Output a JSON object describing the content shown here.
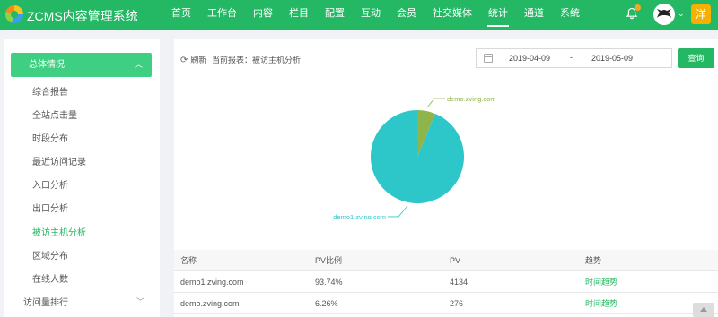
{
  "header": {
    "brand": "ZCMS内容管理系统",
    "nav": [
      "首页",
      "工作台",
      "内容",
      "栏目",
      "配置",
      "互动",
      "会员",
      "社交媒体",
      "统计",
      "通道",
      "系统"
    ],
    "active_nav": "统计",
    "user_badge": "洋",
    "notification_count": "0"
  },
  "sidebar": {
    "group_label": "总体情况",
    "items": [
      "综合报告",
      "全站点击量",
      "时段分布",
      "最近访问记录",
      "入口分析",
      "出口分析",
      "被访主机分析",
      "区域分布",
      "在线人数"
    ],
    "active_item": "被访主机分析",
    "group2_label": "访问量排行"
  },
  "toolbar": {
    "refresh": "刷新",
    "current_report": "当前报表：被访主机分析",
    "date_from": "2019-04-09",
    "date_sep": "-",
    "date_to": "2019-05-09",
    "query": "查询"
  },
  "chart_data": {
    "type": "pie",
    "slices": [
      {
        "label": "demo1.zving.com",
        "value": 4134,
        "percent": 93.74,
        "color": "#2ec7c9"
      },
      {
        "label": "demo.zving.com",
        "value": 276,
        "percent": 6.26,
        "color": "#8fb54a"
      }
    ]
  },
  "table": {
    "headers": [
      "名称",
      "PV比例",
      "PV",
      "趋势"
    ],
    "rows": [
      [
        "demo1.zving.com",
        "93.74%",
        "4134",
        "时间趋势"
      ],
      [
        "demo.zving.com",
        "6.26%",
        "276",
        "时间趋势"
      ]
    ]
  }
}
